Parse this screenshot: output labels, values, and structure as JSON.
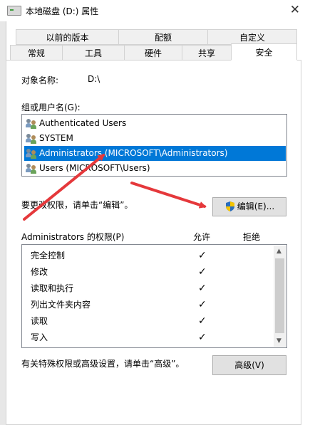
{
  "window": {
    "title": "本地磁盘 (D:) 属性",
    "close_glyph": "✕"
  },
  "tabs_row1": [
    "以前的版本",
    "配额",
    "自定义"
  ],
  "tabs_row2": [
    "常规",
    "工具",
    "硬件",
    "共享",
    "安全"
  ],
  "active_tab": "安全",
  "object": {
    "label": "对象名称:",
    "value": "D:\\"
  },
  "groups": {
    "label": "组或用户名(G):",
    "items": [
      "Authenticated Users",
      "SYSTEM",
      "Administrators (MICROSOFT\\Administrators)",
      "Users (MICROSOFT\\Users)"
    ],
    "selected_index": 2
  },
  "edit": {
    "hint": "要更改权限，请单击“编辑”。",
    "button": "编辑(E)..."
  },
  "permissions": {
    "label": "Administrators 的权限(P)",
    "allow_header": "允许",
    "deny_header": "拒绝",
    "check_glyph": "✓",
    "rows": [
      {
        "name": "完全控制",
        "allow": true
      },
      {
        "name": "修改",
        "allow": true
      },
      {
        "name": "读取和执行",
        "allow": true
      },
      {
        "name": "列出文件夹内容",
        "allow": true
      },
      {
        "name": "读取",
        "allow": true
      },
      {
        "name": "写入",
        "allow": true
      }
    ]
  },
  "advanced": {
    "hint": "有关特殊权限或高级设置，请单击“高级”。",
    "button": "高级(V)"
  },
  "colors": {
    "selection": "#0078d7",
    "arrow": "#e5383b"
  }
}
